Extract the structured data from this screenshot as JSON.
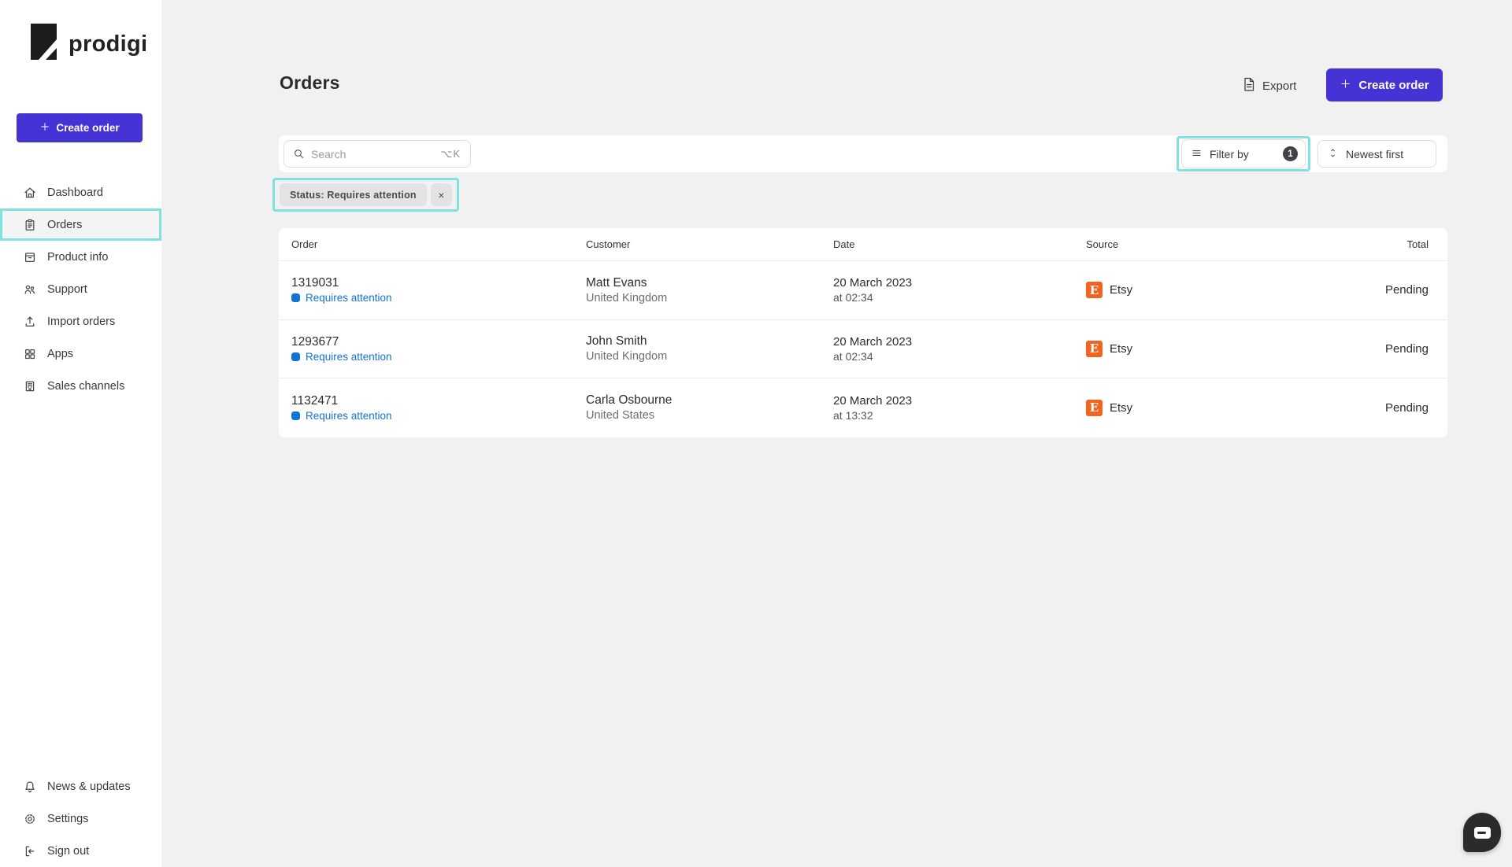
{
  "brand": {
    "name": "prodigi"
  },
  "sidebar": {
    "create_order": "Create order",
    "items": [
      {
        "label": "Dashboard",
        "icon": "home-icon"
      },
      {
        "label": "Orders",
        "icon": "orders-icon",
        "active": true
      },
      {
        "label": "Product info",
        "icon": "product-info-icon"
      },
      {
        "label": "Support",
        "icon": "support-icon"
      },
      {
        "label": "Import orders",
        "icon": "import-icon"
      },
      {
        "label": "Apps",
        "icon": "apps-icon"
      },
      {
        "label": "Sales channels",
        "icon": "sales-channels-icon"
      }
    ],
    "footer_items": [
      {
        "label": "News & updates",
        "icon": "bell-icon"
      },
      {
        "label": "Settings",
        "icon": "gear-icon"
      },
      {
        "label": "Sign out",
        "icon": "sign-out-icon"
      }
    ]
  },
  "header": {
    "title": "Orders",
    "export": "Export",
    "create_order": "Create order"
  },
  "toolbar": {
    "search_placeholder": "Search",
    "search_shortcut": "⌥K",
    "filter_by": "Filter by",
    "filter_count": "1",
    "sort": "Newest first"
  },
  "filter_chip": {
    "label": "Status: Requires attention",
    "remove": "×"
  },
  "table": {
    "columns": [
      "Order",
      "Customer",
      "Date",
      "Source",
      "Total"
    ],
    "rows": [
      {
        "order_id": "1319031",
        "status": "Requires attention",
        "customer": "Matt Evans",
        "country": "United Kingdom",
        "date": "20 March 2023",
        "time": "at 02:34",
        "source": "Etsy",
        "source_initial": "E",
        "total": "Pending"
      },
      {
        "order_id": "1293677",
        "status": "Requires attention",
        "customer": "John Smith",
        "country": "United Kingdom",
        "date": "20 March 2023",
        "time": "at 02:34",
        "source": "Etsy",
        "source_initial": "E",
        "total": "Pending"
      },
      {
        "order_id": "1132471",
        "status": "Requires attention",
        "customer": "Carla Osbourne",
        "country": "United States",
        "date": "20 March 2023",
        "time": "at 13:32",
        "source": "Etsy",
        "source_initial": "E",
        "total": "Pending"
      }
    ]
  },
  "colors": {
    "accent_purple": "#4533d6",
    "link_blue": "#1173d4",
    "etsy_orange": "#f1641e",
    "annotation_cyan": "#7ee2e0",
    "background": "#f1f1f2",
    "surface": "#ffffff"
  }
}
